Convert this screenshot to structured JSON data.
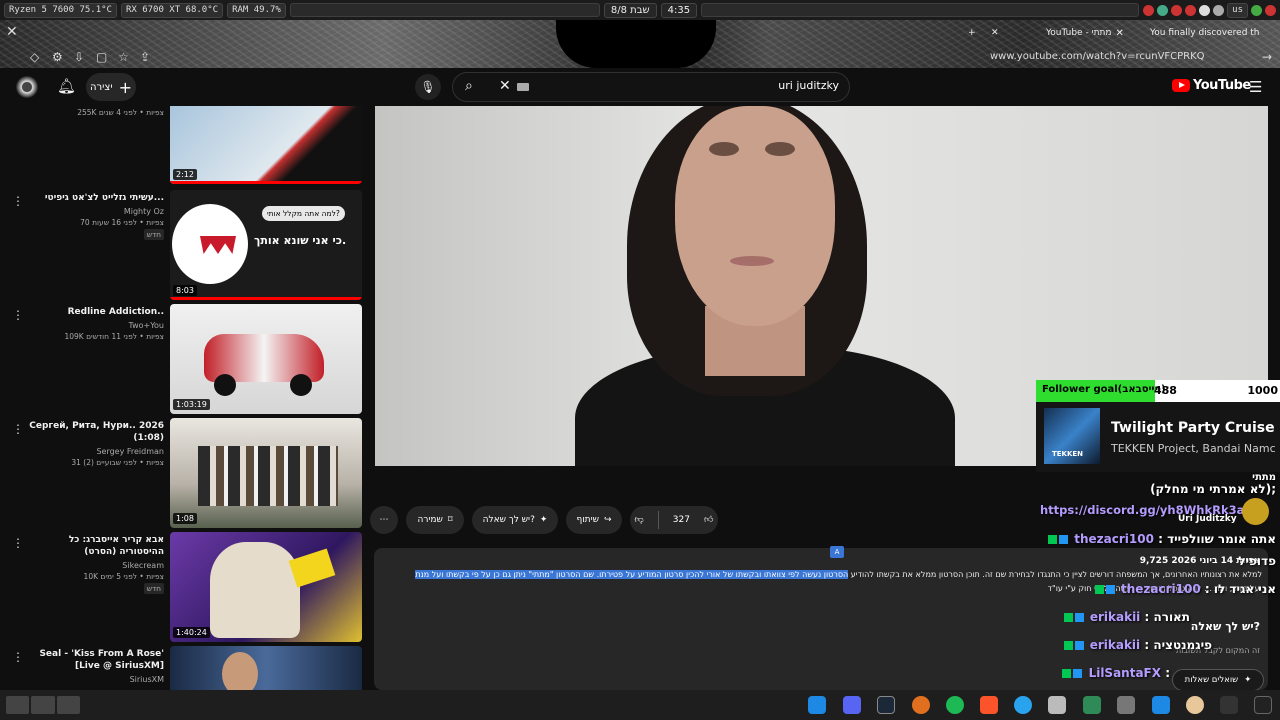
{
  "system": {
    "cpu": "Ryzen 5 7600  75.1°C",
    "gpu": "RX 6700 XT  68.0°C",
    "ram": "RAM   49.7%",
    "date": "8/8 שבת",
    "time": "4:35",
    "locale": "us"
  },
  "browser": {
    "tab1": "YouTube - מתתי",
    "tab2": "You finally discovered th",
    "url": "www.youtube.com/watch?v=rcunVFCPRKQ"
  },
  "header": {
    "create_label": "יצירה",
    "search_value": "uri juditzky",
    "logo_text": "YouTube"
  },
  "recommendations": [
    {
      "title": "",
      "channel": "",
      "stats": "255K צפיות • לפני 4 שנים",
      "badge": "",
      "duration": "2:12"
    },
    {
      "title": "עשיתי גזלייט לצ'אט גיפיטי...",
      "channel": "Mighty Oz",
      "stats": "70 צפיות • לפני 16 שעות",
      "badge": "חדש",
      "duration": "8:03",
      "thumb_text1": "למה אתה מקלל אותי?",
      "thumb_text2": "כי אני שונא אותך."
    },
    {
      "title": "Redline Addiction..",
      "channel": "Two+You",
      "stats": "109K צפיות • לפני 11 חודשים",
      "badge": "",
      "duration": "1:03:19"
    },
    {
      "title": "Сергей, Рита, Нури.. 2026 (1:08)",
      "channel": "Sergey Freidman",
      "stats": "31 צפיות • לפני שבועיים (2)",
      "badge": "",
      "duration": "1:08"
    },
    {
      "title": "אבא קריר אייסברג: כל ההיסטוריה (הסרט)",
      "channel": "Sikecream",
      "stats": "10K צפיות • לפני 5 ימים",
      "badge": "חדש",
      "duration": "1:40:24"
    },
    {
      "title": "Seal - 'Kiss From A Rose' [Live @ SiriusXM]",
      "channel": "SiriusXM",
      "stats": "",
      "badge": "",
      "duration": ""
    }
  ],
  "overlay": {
    "follower_label": "Follower goal(פייסבאב):",
    "follower_count": "488",
    "follower_goal": "1000",
    "follower_progress": 0.488,
    "np_title": "Twilight Party Cruise - N",
    "np_artist": "TEKKEN Project, Bandai Namc",
    "np_art_text": "TEKKEN"
  },
  "actions": {
    "likes": "327",
    "share": "שיתוף",
    "ask": "יש לך שאלה?",
    "save": "שמירה"
  },
  "description": {
    "stats": "9,725 צפיות  14 ביוני 2026",
    "line1_plain": "הסרטון נעשה לפי צוואתו ובקשתו של אורי להכין סרטון המודיע על פטירתו. שם הסרטון \"מתתי\" ניתן גם כן על פי בקשתו ועל מנת",
    "line1_rest": "למלא את רצונותיו האחרונים, אך המשפחה דורשים לציין כי התנגדו לבחירת שם זה. תוכן הסרטון ממלא את בקשתו להודיע",
    "line2": "על מותו, ואת ... לווה טופל ואושר כי נעשה על פי חוק ע\"י עו\"ד.",
    "ask_title": "יש לך שאלה?",
    "ask_sub": "זה המקום לקבל תשובות",
    "ask_button": "שואלים שאלות"
  },
  "chat": {
    "header": "מתתי",
    "msg1": "(לא אמרתי מי מחלק);",
    "discord": "https://discord.gg/yh8WhkRk3a",
    "channel": "Uri Juditzky",
    "lines": [
      {
        "user": "thezacri100",
        "text": "אתה אומר שוולפייד"
      },
      {
        "user": "",
        "text": "פדופיל"
      },
      {
        "user": "thezacri100",
        "text": "אני אגיד לו"
      },
      {
        "user": "erikakii",
        "text": "תאורה"
      },
      {
        "user": "erikakii",
        "text": "פיגמנטציה"
      },
      {
        "user": "LilSantaFX",
        "text": ""
      }
    ]
  }
}
